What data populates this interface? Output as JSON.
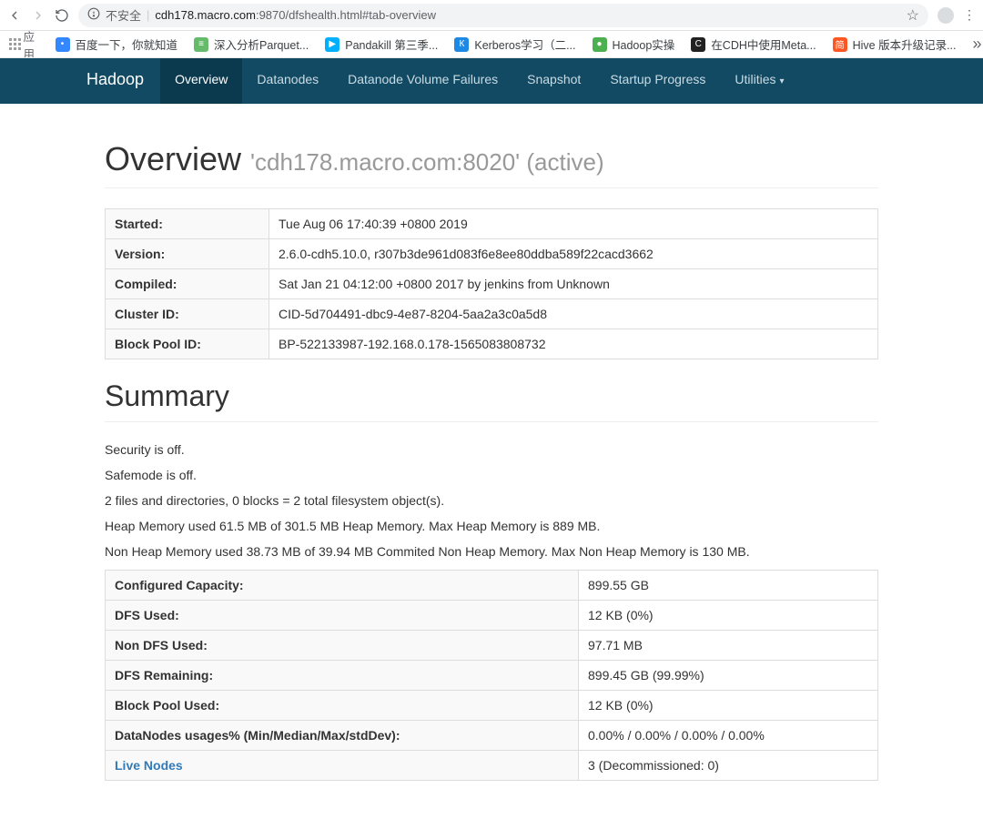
{
  "browser": {
    "insecure_label": "不安全",
    "url_host": "cdh178.macro.com",
    "url_port": ":9870",
    "url_path": "/dfshealth.html#tab-overview"
  },
  "bookmarks": {
    "apps": "应用",
    "items": [
      {
        "label": "百度一下，你就知道",
        "color": "#3388ff",
        "glyph": "熊"
      },
      {
        "label": "深入分析Parquet...",
        "color": "#2e7d32",
        "glyph": "≡"
      },
      {
        "label": "Pandakill 第三季...",
        "color": "#00b0ff",
        "glyph": "▶"
      },
      {
        "label": "Kerberos学习（二...",
        "color": "#1e88e5",
        "glyph": "K"
      },
      {
        "label": "Hadoop实操",
        "color": "#4caf50",
        "glyph": "●"
      },
      {
        "label": "在CDH中使用Meta...",
        "color": "#212121",
        "glyph": "C"
      },
      {
        "label": "Hive 版本升级记录...",
        "color": "#ff5722",
        "glyph": "简"
      }
    ]
  },
  "nav": {
    "brand": "Hadoop",
    "tabs": [
      "Overview",
      "Datanodes",
      "Datanode Volume Failures",
      "Snapshot",
      "Startup Progress"
    ],
    "utilities": "Utilities"
  },
  "overview": {
    "title": "Overview",
    "host": "'cdh178.macro.com:8020' (active)",
    "rows": [
      {
        "k": "Started:",
        "v": "Tue Aug 06 17:40:39 +0800 2019"
      },
      {
        "k": "Version:",
        "v": "2.6.0-cdh5.10.0, r307b3de961d083f6e8ee80ddba589f22cacd3662"
      },
      {
        "k": "Compiled:",
        "v": "Sat Jan 21 04:12:00 +0800 2017 by jenkins from Unknown"
      },
      {
        "k": "Cluster ID:",
        "v": "CID-5d704491-dbc9-4e87-8204-5aa2a3c0a5d8"
      },
      {
        "k": "Block Pool ID:",
        "v": "BP-522133987-192.168.0.178-1565083808732"
      }
    ]
  },
  "summary": {
    "title": "Summary",
    "lines": [
      "Security is off.",
      "Safemode is off.",
      "2 files and directories, 0 blocks = 2 total filesystem object(s).",
      "Heap Memory used 61.5 MB of 301.5 MB Heap Memory. Max Heap Memory is 889 MB.",
      "Non Heap Memory used 38.73 MB of 39.94 MB Commited Non Heap Memory. Max Non Heap Memory is 130 MB."
    ],
    "table": [
      {
        "k": "Configured Capacity:",
        "v": "899.55 GB"
      },
      {
        "k": "DFS Used:",
        "v": "12 KB (0%)"
      },
      {
        "k": "Non DFS Used:",
        "v": "97.71 MB"
      },
      {
        "k": "DFS Remaining:",
        "v": "899.45 GB (99.99%)"
      },
      {
        "k": "Block Pool Used:",
        "v": "12 KB (0%)"
      },
      {
        "k": "DataNodes usages% (Min/Median/Max/stdDev):",
        "v": "0.00% / 0.00% / 0.00% / 0.00%"
      }
    ],
    "live_nodes_label": "Live Nodes",
    "live_nodes_value": "3 (Decommissioned: 0)"
  }
}
